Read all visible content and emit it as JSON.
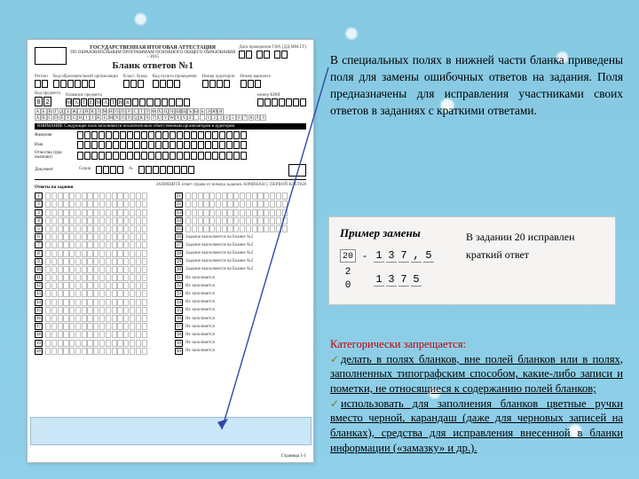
{
  "form": {
    "header": {
      "line1": "ГОСУДАРСТВЕННАЯ ИТОГОВАЯ АТТЕСТАЦИЯ",
      "line2": "ПО ОБРАЗОВАТЕЛЬНЫМ ПРОГРАММАМ ОСНОВНОГО ОБЩЕГО ОБРАЗОВАНИЯ – 2015",
      "title": "Бланк ответов №1",
      "date_label": "Дата проведения ГИА (ДД.ММ.ГГ)"
    },
    "row_labels": [
      "Регион",
      "Код образовательной организации",
      "Класс. буква",
      "Код пункта проведения",
      "Номер аудитории",
      "Номер варианта"
    ],
    "row3": {
      "code_label": "Код предмета",
      "code": "02",
      "name_label": "Название предмета",
      "name": [
        "М",
        "А",
        "Т",
        "Е",
        "М",
        "А",
        "Т",
        "И",
        "К"
      ],
      "kim_label": "номер КИМ"
    },
    "alphabet_ru": "А Б В Г Д Е Ж З И К Л М Н О П Р С Т У Ф Х Ц Ч Ш Щ Ъ Ы Ь Э Ю Я",
    "alphabet_lat": "A B C D E F G H I J K L M N O P Q R S T U V W X Y Z , . 1 2 3 4 5 6 7 8 9 0",
    "blackbar": "ВНИМАНИЕ   Следующие поля заполняются исключительно ответственным организатором в аудитории",
    "personal": [
      "Фамилия",
      "Имя",
      "Отчество (при наличии)"
    ],
    "doc_row": {
      "doc": "Документ",
      "ser": "Серия",
      "num": "№"
    },
    "answers_title": "Ответы на задания",
    "answers_hint": "ЗАПИШИТЕ ответ справа от номера задания, НАЧИНАЯ С ПЕРВОЙ КЛЕТКИ",
    "right_notes": [
      "Задание выполняется на Бланке №2",
      "Задание выполняется на Бланке №2",
      "Задание выполняется на Бланке №2",
      "Задание выполняется на Бланке №2",
      "Задание выполняется на Бланке №2",
      "Не заполняется",
      "Не заполняется",
      "Не заполняется",
      "Не заполняется",
      "Не заполняется"
    ],
    "footer": {
      "page_label": "Страница 1-1"
    }
  },
  "paragraph1": "В специальных полях в нижней части бланка приведены поля для замены ошибочных ответов на задания. Поля предназначены для исправления участниками своих ответов в заданиях с краткими ответами.",
  "example": {
    "title": "Пример замены",
    "row1": {
      "task": "20",
      "digits": [
        "1",
        "3",
        "7",
        ",",
        "5"
      ]
    },
    "row2": {
      "task": "2 0",
      "digits": [
        "1",
        "3",
        "7",
        "5"
      ]
    },
    "right_text_1": "В    задании    20    исправлен",
    "right_text_2": "краткий ответ"
  },
  "para2": {
    "heading": "Категорически запрещается:",
    "item1": "делать в полях бланков, вне полей бланков или в полях, заполненных типографским способом, какие-либо записи и пометки, не относящиеся к содержанию полей бланков;",
    "item2": "использовать для заполнения бланков цветные ручки вместо черной, карандаш (даже для черновых записей на бланках), средства для исправления внесенной в бланки информации («замазку» и др.)."
  }
}
